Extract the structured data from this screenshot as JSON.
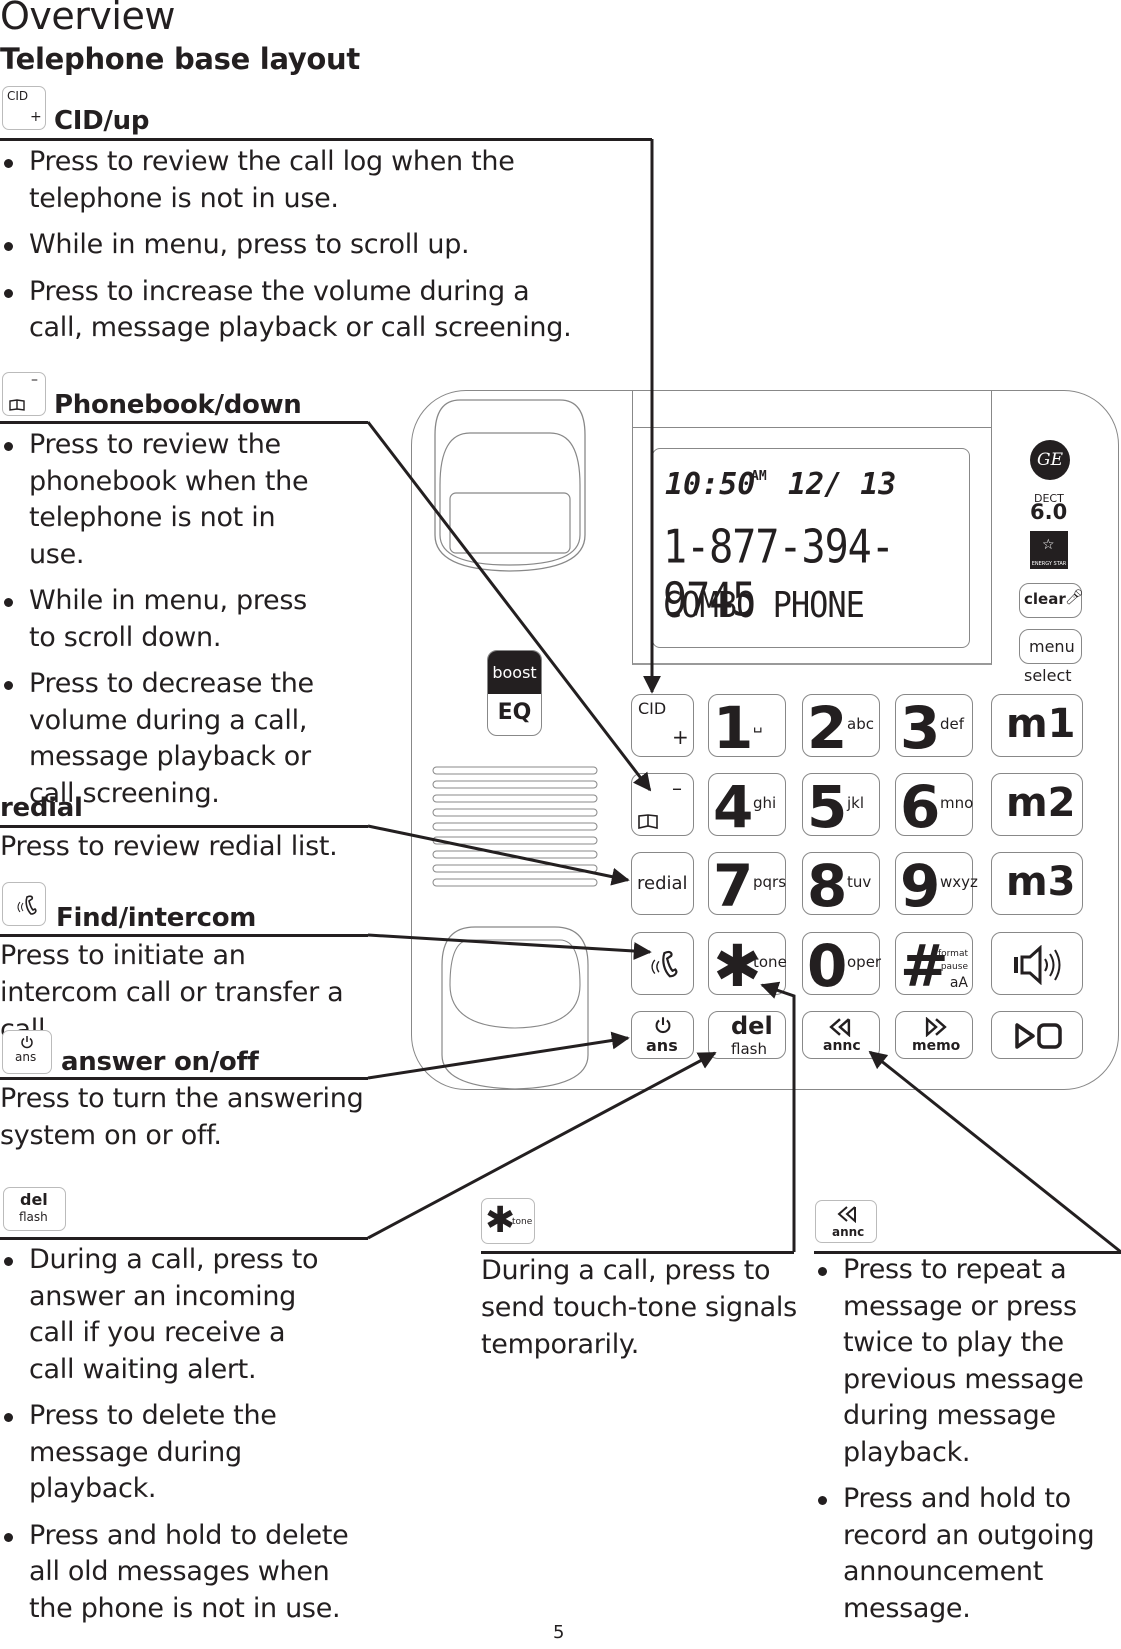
{
  "page": {
    "title": "Overview",
    "subtitle": "Telephone base layout",
    "page_number": "5"
  },
  "sections": {
    "cid": {
      "title": "CID/up",
      "icon_label_top": "CID",
      "icon_label_bottom": "+",
      "bullets": [
        "Press to review the call log when the telephone is not in use.",
        "While in menu, press to scroll up.",
        "Press to increase the volume during a call, message playback or call screening."
      ]
    },
    "phonebook": {
      "title": "Phonebook/down",
      "icon_label_top": "–",
      "bullets": [
        "Press to review the phonebook when the telephone is not in use.",
        "While in menu, press to scroll down.",
        "Press to decrease the volume during a call, message playback or call screening."
      ]
    },
    "redial": {
      "title": "redial",
      "text": "Press to review redial list."
    },
    "find": {
      "title": "Find/intercom",
      "text": "Press to initiate an intercom call or transfer a call."
    },
    "answer": {
      "title": "answer on/off",
      "icon_label": "ans",
      "text": "Press to turn the answering system on or off."
    },
    "del": {
      "icon_label_top": "del",
      "icon_label_bottom": "flash",
      "bullets": [
        "During a call, press to answer an incoming call if you receive a call waiting alert.",
        "Press to delete the message during playback.",
        "Press and hold to delete all old messages when the phone is not in use."
      ]
    },
    "tone": {
      "icon_label": "tone",
      "text": "During a call, press to send touch-tone signals temporarily."
    },
    "annc": {
      "icon_label": "annc",
      "bullets": [
        "Press to repeat a message or press twice to play the previous message during message playback.",
        "Press and hold to record an outgoing announcement message."
      ]
    }
  },
  "phone": {
    "display": {
      "time": "10:50",
      "ampm": "AM",
      "date": "12/ 13",
      "number": "1-877-394-9745",
      "name": "COMBO PHONE"
    },
    "brand": {
      "logo": "GE",
      "dect_label": "DECT",
      "dect_version": "6.0",
      "energy_star": "ENERGY STAR"
    },
    "side_buttons": {
      "clear": "clear",
      "menu": "menu",
      "select": "select",
      "boost": "boost",
      "eq": "EQ"
    },
    "keys": [
      {
        "big": "1",
        "sub": "␣"
      },
      {
        "big": "2",
        "sub": "abc"
      },
      {
        "big": "3",
        "sub": "def"
      },
      {
        "big": "4",
        "sub": "ghi"
      },
      {
        "big": "5",
        "sub": "jkl"
      },
      {
        "big": "6",
        "sub": "mno"
      },
      {
        "big": "7",
        "sub": "pqrs"
      },
      {
        "big": "8",
        "sub": "tuv"
      },
      {
        "big": "9",
        "sub": "wxyz"
      },
      {
        "big": "✱",
        "sub": "tone"
      },
      {
        "big": "0",
        "sub": "oper"
      },
      {
        "big": "#",
        "sub1": "format",
        "sub2": "pause",
        "sub3": "aA"
      }
    ],
    "left_keys": {
      "cid": "CID",
      "plus": "+",
      "minus": "–",
      "redial": "redial",
      "ans": "ans"
    },
    "memory_keys": [
      "m1",
      "m2",
      "m3"
    ],
    "bottom_keys": {
      "del": "del",
      "flash": "flash",
      "annc": "annc",
      "memo": "memo"
    }
  },
  "colors": {
    "ink": "#231f20",
    "outline": "#888888"
  }
}
